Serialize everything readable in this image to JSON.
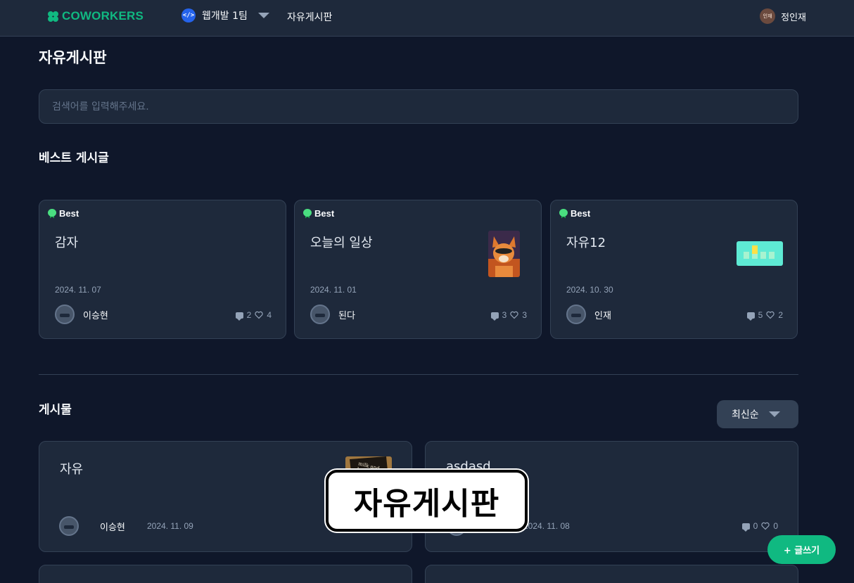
{
  "nav": {
    "logo": "COWORKERS",
    "team_name": "웹개발 1팀",
    "board_link": "자유게시판",
    "user_avatar_text": "인재",
    "user_name": "정인재"
  },
  "page_title": "자유게시판",
  "search": {
    "placeholder": "검색어를 입력해주세요."
  },
  "best": {
    "title": "베스트 게시글",
    "badge": "Best",
    "cards": [
      {
        "title": "감자",
        "date": "2024. 11. 07",
        "author": "이승현",
        "comments": "2",
        "likes": "4",
        "thumb": "none"
      },
      {
        "title": "오늘의 일상",
        "date": "2024. 11. 01",
        "author": "된다",
        "comments": "3",
        "likes": "3",
        "thumb": "cat-photo"
      },
      {
        "title": "자유12",
        "date": "2024. 10. 30",
        "author": "인재",
        "comments": "5",
        "likes": "2",
        "thumb": "chart-image"
      }
    ]
  },
  "posts": {
    "title": "게시물",
    "sort_label": "최신순",
    "items": [
      {
        "title": "자유",
        "author": "이승현",
        "date": "2024. 11. 09",
        "thumb": "book-photo"
      },
      {
        "title": "asdasd",
        "author": "",
        "date": "2024. 11. 08",
        "comments": "0",
        "likes": "0"
      }
    ]
  },
  "overlay_label": "자유게시판",
  "write_button": "+ 글쓰기",
  "colors": {
    "background": "#0f172a",
    "surface": "#1e293b",
    "brand": "#10b981"
  }
}
